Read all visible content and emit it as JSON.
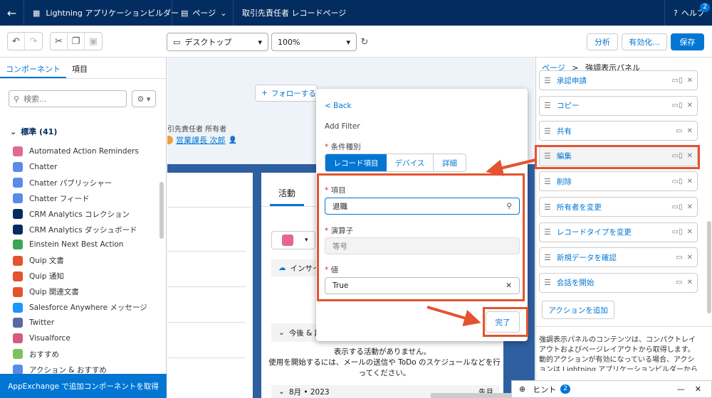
{
  "topbar": {
    "app_title": "Lightning アプリケーションビルダー",
    "page_menu": "ページ",
    "record_page": "取引先責任者 レコードページ",
    "help": "ヘルプ",
    "help_badge": "2"
  },
  "toolbar": {
    "device_select": "デスクトップ",
    "zoom_select": "100%",
    "analyze": "分析",
    "activate": "有効化...",
    "save": "保存"
  },
  "left": {
    "tab_components": "コンポーネント",
    "tab_fields": "項目",
    "search_placeholder": "検索...",
    "section": "標準 (41)",
    "items": [
      {
        "label": "Automated Action Reminders",
        "color": "#e3678f",
        "icon": "reminder-icon"
      },
      {
        "label": "Chatter",
        "color": "#5a8be8",
        "icon": "pulse-icon"
      },
      {
        "label": "Chatter パブリッシャー",
        "color": "#5a8be8",
        "icon": "publisher-icon"
      },
      {
        "label": "Chatter フィード",
        "color": "#5a8be8",
        "icon": "feed-icon"
      },
      {
        "label": "CRM Analytics コレクション",
        "color": "#032d60",
        "icon": "bar-chart-icon"
      },
      {
        "label": "CRM Analytics ダッシュボード",
        "color": "#032d60",
        "icon": "bar-chart-icon"
      },
      {
        "label": "Einstein Next Best Action",
        "color": "#3ba755",
        "icon": "einstein-icon"
      },
      {
        "label": "Quip 文書",
        "color": "#e4532f",
        "icon": "quip-icon"
      },
      {
        "label": "Quip 通知",
        "color": "#e4532f",
        "icon": "quip-icon"
      },
      {
        "label": "Quip 関連文書",
        "color": "#e4532f",
        "icon": "quip-icon"
      },
      {
        "label": "Salesforce Anywhere メッセージ",
        "color": "#1b96ff",
        "icon": "chat-icon"
      },
      {
        "label": "Twitter",
        "color": "#5867a8",
        "icon": "twitter-icon"
      },
      {
        "label": "Visualforce",
        "color": "#d55a85",
        "icon": "code-icon"
      },
      {
        "label": "おすすめ",
        "color": "#7ec15d",
        "icon": "lightbulb-icon"
      },
      {
        "label": "アクション & おすすめ",
        "color": "#5a8be8",
        "icon": "list-icon"
      }
    ],
    "appexchange": "AppExchange で追加コンポーネントを取得"
  },
  "canvas": {
    "follow_button": "フォローする",
    "owner_label": "引先責任者 所有者",
    "owner_name": "営業課長 次郎",
    "activity_tab": "活動",
    "insight_label": "インサイ",
    "upcoming": "今後 & 期",
    "no_activity": "表示する活動がありません。",
    "no_activity_help": "使用を開始するには、メールの送信や ToDo のスケジュールなどを行ってください。",
    "month": "8月 • 2023",
    "overdue": "先月"
  },
  "popup": {
    "back": "< Back",
    "title": "Add Filter",
    "condition_label": "条件種別",
    "seg_record": "レコード項目",
    "seg_device": "デバイス",
    "seg_detail": "詳細",
    "field_label": "項目",
    "field_value": "退職",
    "operator_label": "演算子",
    "operator_value": "等号",
    "value_label": "値",
    "value_value": "True",
    "done": "完了"
  },
  "right": {
    "crumb_page": "ページ",
    "crumb_current": "強調表示パネル",
    "actions": [
      {
        "label": "承認申請",
        "icon": "tablet-icon"
      },
      {
        "label": "コピー",
        "icon": "tablet-icon"
      },
      {
        "label": "共有",
        "icon": "desktop-icon"
      },
      {
        "label": "編集",
        "icon": "tablet-icon"
      },
      {
        "label": "削除",
        "icon": "tablet-icon"
      },
      {
        "label": "所有者を変更",
        "icon": "tablet-icon"
      },
      {
        "label": "レコードタイプを変更",
        "icon": "tablet-icon"
      },
      {
        "label": "新規データを確認",
        "icon": "desktop-icon"
      },
      {
        "label": "会話を開始",
        "icon": "desktop-icon"
      }
    ],
    "add_action": "アクションを追加",
    "description": "強調表示パネルのコンテンツは、コンパクトレイアウトおよびページレイアウトから取得します。動的アクションが有効になっている場合、アクションは Lightning アプリケーションビルダーから取得します。"
  },
  "hint": {
    "label": "ヒント",
    "badge": "2"
  },
  "colors": {
    "header": "#032d60",
    "brand": "#0176d3",
    "annotation": "#e4532f"
  }
}
